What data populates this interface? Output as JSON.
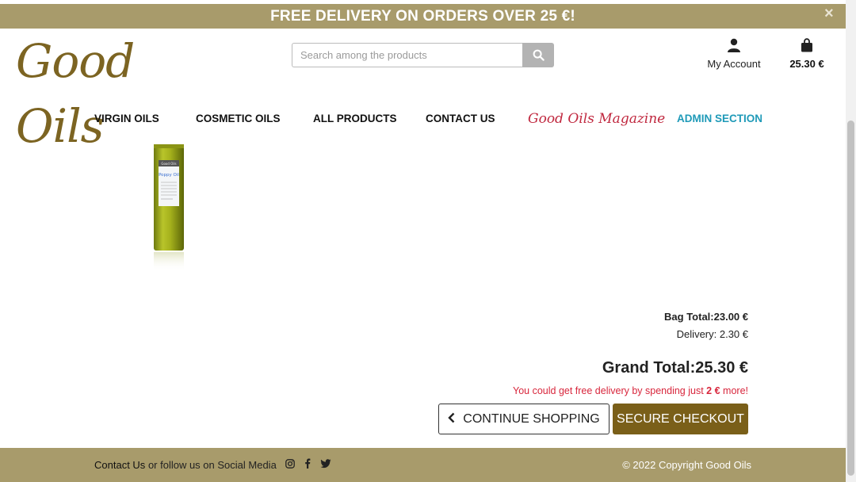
{
  "banner": {
    "text": "FREE DELIVERY ON ORDERS OVER 25 €!",
    "close_icon": "×"
  },
  "header": {
    "logo_text": "Good Oils",
    "search_placeholder": "Search among the products",
    "search_value": "",
    "account_label": "My Account",
    "cart_total": "25.30 €"
  },
  "nav": {
    "items": [
      {
        "label": "VIRGIN OILS"
      },
      {
        "label": "COSMETIC OILS"
      },
      {
        "label": "ALL PRODUCTS"
      },
      {
        "label": "CONTACT US"
      },
      {
        "label": "Good Oils Magazine"
      },
      {
        "label": "ADMIN SECTION"
      }
    ]
  },
  "product": {
    "label_brand": "Good Oils",
    "label_name": "Poppy Oil"
  },
  "summary": {
    "bag_total": "Bag Total:23.00 €",
    "delivery": "Delivery: 2.30 €",
    "grand_total": "Grand Total:25.30 €",
    "free_msg_prefix": "You could get free delivery by spending just",
    "free_msg_amount": "2 €",
    "free_msg_suffix": "more!"
  },
  "actions": {
    "continue_label": "CONTINUE SHOPPING",
    "checkout_label": "SECURE CHECKOUT"
  },
  "footer": {
    "contact_link": "Contact Us",
    "follow_text": "or follow us on Social Media",
    "copyright": "© 2022 Copyright Good Oils"
  },
  "icons": {
    "search": "search-icon",
    "account": "user-icon",
    "cart": "shopping-bag-icon",
    "close": "close-icon",
    "chevron": "chevron-left-icon",
    "instagram": "instagram-icon",
    "facebook": "facebook-icon",
    "twitter": "twitter-icon"
  },
  "colors": {
    "banner_bg": "#a89b6b",
    "brand_brown": "#7a5f19",
    "magazine_red": "#c0283f",
    "admin_blue": "#1f9ab8",
    "alert_red": "#d8263c"
  }
}
